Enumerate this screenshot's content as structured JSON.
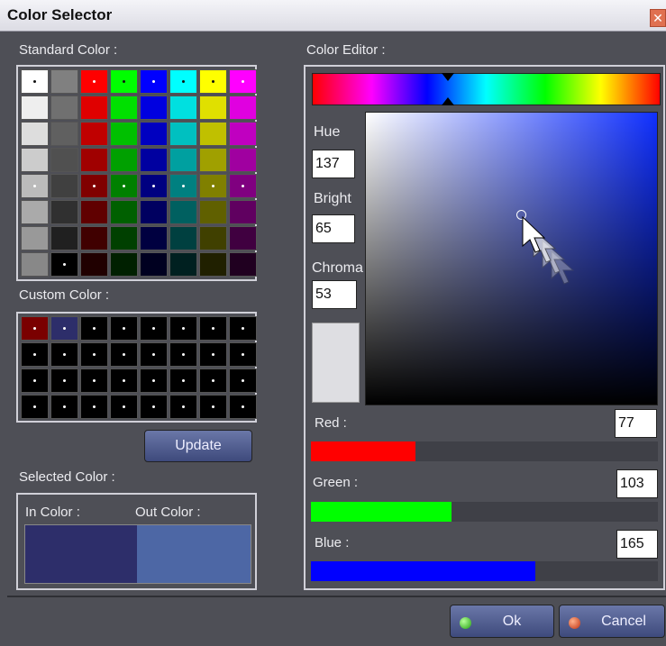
{
  "window": {
    "title": "Color Selector",
    "close_icon": "close-icon"
  },
  "standard": {
    "label": "Standard Color :",
    "colors": [
      "#ffffff",
      "#808080",
      "#ff0000",
      "#00ff00",
      "#0000ff",
      "#00ffff",
      "#ffff00",
      "#ff00ff",
      "#eeeeee",
      "#707070",
      "#e00000",
      "#00e000",
      "#0000e0",
      "#00e0e0",
      "#e0e000",
      "#e000e0",
      "#dddddd",
      "#606060",
      "#c00000",
      "#00c000",
      "#0000c0",
      "#00c0c0",
      "#c0c000",
      "#c000c0",
      "#cccccc",
      "#505050",
      "#a00000",
      "#00a000",
      "#0000a0",
      "#00a0a0",
      "#a0a000",
      "#a000a0",
      "#bbbbbb",
      "#404040",
      "#800000",
      "#008000",
      "#000080",
      "#008080",
      "#808000",
      "#800080",
      "#aaaaaa",
      "#303030",
      "#600000",
      "#006000",
      "#000060",
      "#006060",
      "#606000",
      "#600060",
      "#999999",
      "#202020",
      "#400000",
      "#004000",
      "#000040",
      "#004040",
      "#404000",
      "#400040",
      "#888888",
      "#000000",
      "#200000",
      "#002000",
      "#000020",
      "#002020",
      "#202000",
      "#200020"
    ],
    "dots": [
      0,
      2,
      3,
      4,
      5,
      6,
      7,
      32,
      34,
      35,
      36,
      37,
      38,
      39,
      57
    ]
  },
  "custom": {
    "label": "Custom Color :",
    "colors": [
      "#7a0000",
      "#2d2e6a",
      "#000000",
      "#000000",
      "#000000",
      "#000000",
      "#000000",
      "#000000",
      "#000000",
      "#000000",
      "#000000",
      "#000000",
      "#000000",
      "#000000",
      "#000000",
      "#000000",
      "#000000",
      "#000000",
      "#000000",
      "#000000",
      "#000000",
      "#000000",
      "#000000",
      "#000000",
      "#000000",
      "#000000",
      "#000000",
      "#000000",
      "#000000",
      "#000000",
      "#000000",
      "#000000"
    ]
  },
  "update_label": "Update",
  "selected": {
    "label": "Selected Color :",
    "in_label": "In Color :",
    "out_label": "Out Color :",
    "in_color": "#2d2e6a",
    "out_color": "#4d67a5"
  },
  "editor": {
    "label": "Color Editor :",
    "hue_label": "Hue",
    "hue": "137",
    "bright_label": "Bright",
    "bright": "65",
    "chroma_label": "Chroma",
    "chroma": "53",
    "preview_color": "#dedee2",
    "sv_base": "#1030ff",
    "red_label": "Red :",
    "red": "77",
    "green_label": "Green :",
    "green": "103",
    "blue_label": "Blue :",
    "blue": "165",
    "slider_max": 255,
    "pointer_icon": "arrow-cursor-icon"
  },
  "ok_label": "Ok",
  "cancel_label": "Cancel"
}
